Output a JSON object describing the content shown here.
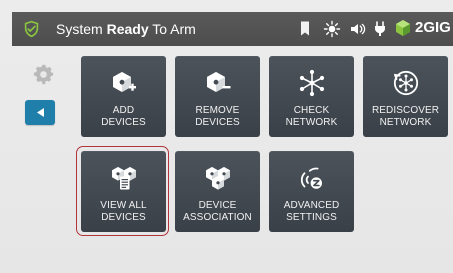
{
  "status_bar": {
    "prefix": "System",
    "emphasis": "Ready",
    "suffix": "To Arm",
    "brand": "2GIG",
    "icons": [
      "shield-check-icon",
      "bookmark-icon",
      "brightness-icon",
      "volume-icon",
      "plug-icon",
      "brand-cube-icon"
    ],
    "colors": {
      "background": "#4f4f4f",
      "accent": "#8bc53f"
    }
  },
  "left_rail": {
    "icons": [
      "gear-icon",
      "back-arrow-icon"
    ],
    "colors": {
      "back_button": "#1f7faa"
    }
  },
  "tiles": [
    {
      "label": "ADD\nDEVICES",
      "icon": "add-devices-icon"
    },
    {
      "label": "REMOVE\nDEVICES",
      "icon": "remove-devices-icon"
    },
    {
      "label": "CHECK\nNETWORK",
      "icon": "check-network-icon"
    },
    {
      "label": "REDISCOVER\nNETWORK",
      "icon": "rediscover-network-icon"
    },
    {
      "label": "VIEW ALL\nDEVICES",
      "icon": "view-all-devices-icon"
    },
    {
      "label": "DEVICE\nASSOCIATION",
      "icon": "device-association-icon"
    },
    {
      "label": "ADVANCED\nSETTINGS",
      "icon": "advanced-settings-icon"
    }
  ],
  "selection": {
    "color": "#b2353c"
  }
}
